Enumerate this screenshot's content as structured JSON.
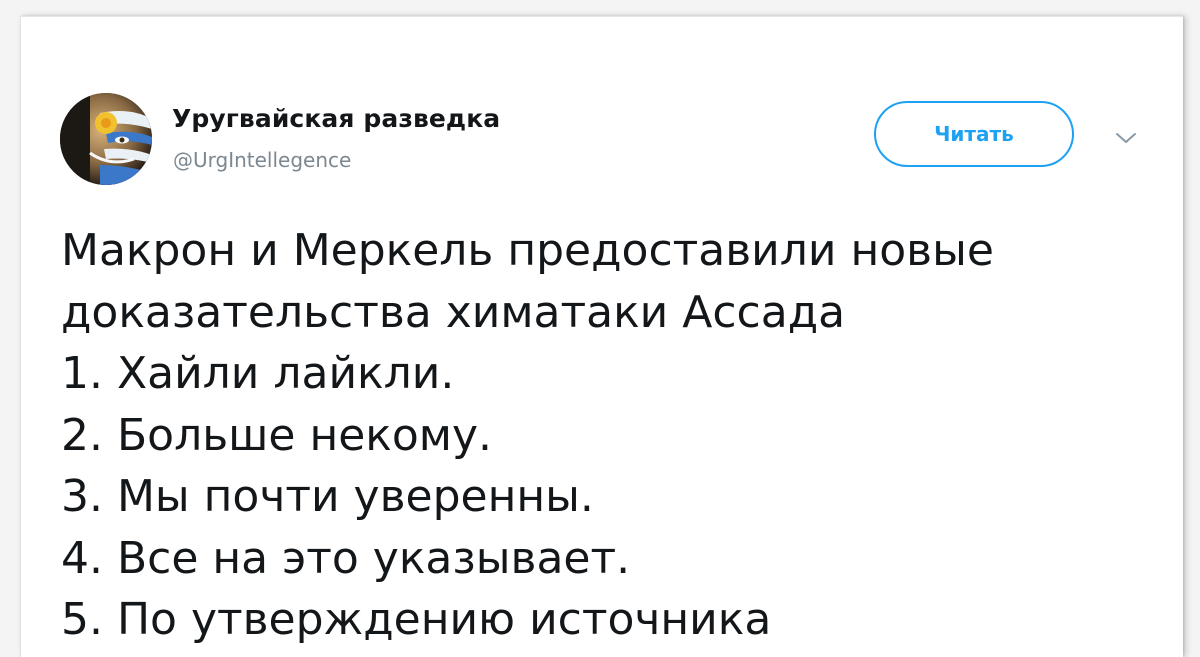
{
  "profile": {
    "display_name": "Уругвайская разведка",
    "handle": "@UrgIntellegence"
  },
  "follow_button_label": "Читать",
  "icons": {
    "avatar": "avatar-flag-face",
    "menu": "chevron-down-icon"
  },
  "colors": {
    "accent": "#1da1f2",
    "text": "#14171a",
    "muted": "#7b8791"
  },
  "tweet": {
    "lines": [
      "Макрон и Меркель предоставили новые",
      "доказательства химатаки Ассада",
      "1. Хайли лайкли.",
      "2. Больше некому.",
      "3. Мы почти уверенны.",
      "4. Все на это указывает.",
      "5. По утверждению источника"
    ]
  }
}
